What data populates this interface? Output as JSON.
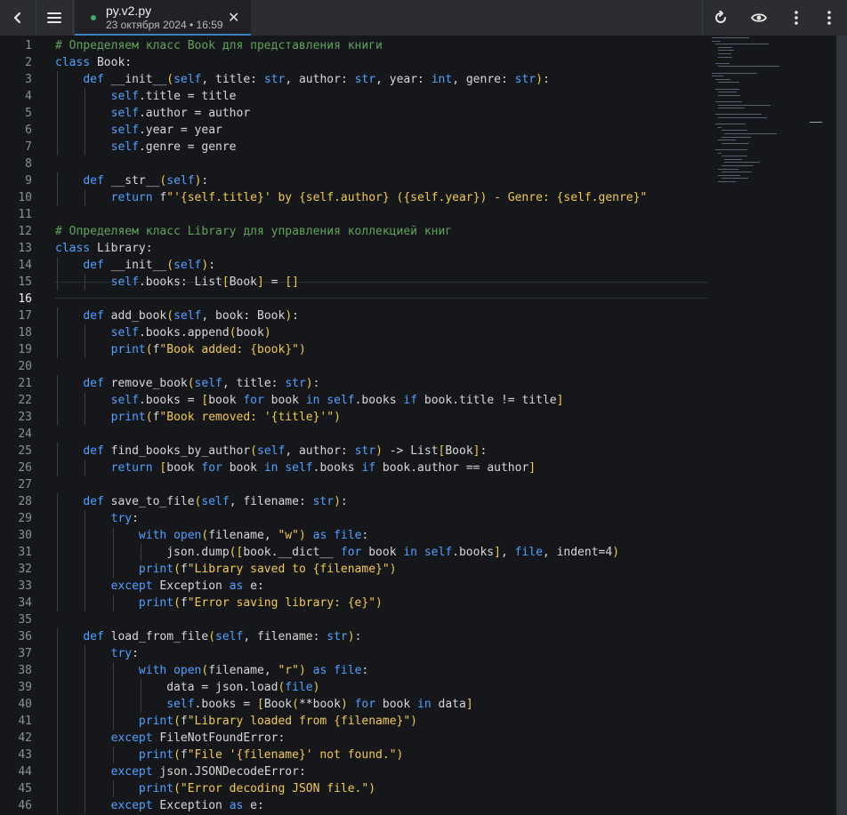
{
  "toolbar": {
    "back_icon": "chevron-left-icon",
    "menu_icon": "hamburger-icon",
    "refresh_icon": "refresh-icon",
    "preview_icon": "eye-icon",
    "more_icon": "kebab-icon",
    "more2_icon": "kebab-icon"
  },
  "tab": {
    "title": "py.v2.py",
    "subtitle": "23 октября 2024 • 16:59",
    "close": "✕"
  },
  "editor": {
    "current_line": 16,
    "lines": [
      "# Определяем класс Book для представления книги",
      "class Book:",
      "    def __init__(self, title: str, author: str, year: int, genre: str):",
      "        self.title = title",
      "        self.author = author",
      "        self.year = year",
      "        self.genre = genre",
      "",
      "    def __str__(self):",
      "        return f\"'{self.title}' by {self.author} ({self.year}) - Genre: {self.genre}\"",
      "",
      "# Определяем класс Library для управления коллекцией книг",
      "class Library:",
      "    def __init__(self):",
      "        self.books: List[Book] = []",
      "",
      "    def add_book(self, book: Book):",
      "        self.books.append(book)",
      "        print(f\"Book added: {book}\")",
      "",
      "    def remove_book(self, title: str):",
      "        self.books = [book for book in self.books if book.title != title]",
      "        print(f\"Book removed: '{title}'\")",
      "",
      "    def find_books_by_author(self, author: str) -> List[Book]:",
      "        return [book for book in self.books if book.author == author]",
      "",
      "    def save_to_file(self, filename: str):",
      "        try:",
      "            with open(filename, \"w\") as file:",
      "                json.dump([book.__dict__ for book in self.books], file, indent=4)",
      "            print(f\"Library saved to {filename}\")",
      "        except Exception as e:",
      "            print(f\"Error saving library: {e}\")",
      "",
      "    def load_from_file(self, filename: str):",
      "        try:",
      "            with open(filename, \"r\") as file:",
      "                data = json.load(file)",
      "                self.books = [Book(**book) for book in data]",
      "            print(f\"Library loaded from {filename}\")",
      "        except FileNotFoundError:",
      "            print(f\"File '{filename}' not found.\")",
      "        except json.JSONDecodeError:",
      "            print(\"Error decoding JSON file.\")",
      "        except Exception as e:"
    ]
  }
}
